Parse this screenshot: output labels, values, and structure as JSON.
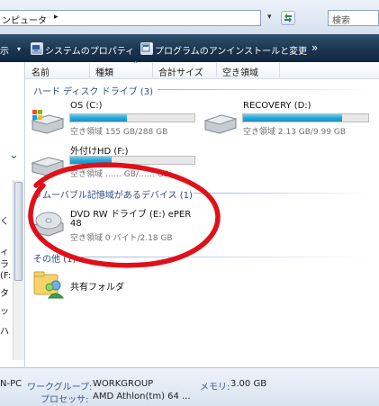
{
  "address": {
    "path": "ンピュータ",
    "arrow": "▸",
    "dropdown_arrow": "▾",
    "refresh_icon": "refresh-icon"
  },
  "search": {
    "placeholder": "検索"
  },
  "toolbar": {
    "partial_label": "示",
    "dropdown": "▾",
    "system_properties": "システムのプロパティ",
    "uninstall": "プログラムのアンインストールと変更",
    "more": "»"
  },
  "columns": {
    "name": "名前",
    "type": "種類",
    "total_size": "合計サイズ",
    "free_space": "空き領域"
  },
  "sort_indicator": "ˆ",
  "nav": {
    "collapse": "⌄",
    "fragments": [
      "く",
      "ィ",
      "ラ",
      "(F:",
      "タ",
      "ッ",
      "ハ"
    ]
  },
  "groups": {
    "hdd": {
      "header": "ハード ディスク ドライブ (3)",
      "drives": [
        {
          "name": "OS (C:)",
          "sub": "空き領域 155 GB/288 GB",
          "fill": 0.46
        },
        {
          "name": "RECOVERY (D:)",
          "sub": "空き領域 2.13 GB/9.99 GB",
          "fill": 0.79
        },
        {
          "name": "外付けHD (F:)",
          "sub": "空き領域 …… GB/…… GB",
          "fill": 0.33
        }
      ]
    },
    "removable": {
      "header": "リムーバブル記憶域があるデバイス (1)",
      "device": {
        "name": "DVD RW ドライブ (E:) ePER",
        "name2": "48",
        "sub": "空き領域 0 バイト/2.18 GB"
      }
    },
    "other": {
      "header": "その他 (1)",
      "item": {
        "name": "共有フォルダ"
      }
    }
  },
  "status": {
    "pc": "N-PC",
    "workgroup_label": "ワークグループ:",
    "workgroup": "WORKGROUP",
    "memory_label": "メモリ:",
    "memory": "3.00 GB",
    "cpu_label": "プロセッサ:",
    "cpu": "AMD Athlon(tm) 64 ..."
  },
  "colors": {
    "accent": "#2a4c8b",
    "annotation": "#e0101a",
    "bar": "#27a7d8"
  }
}
